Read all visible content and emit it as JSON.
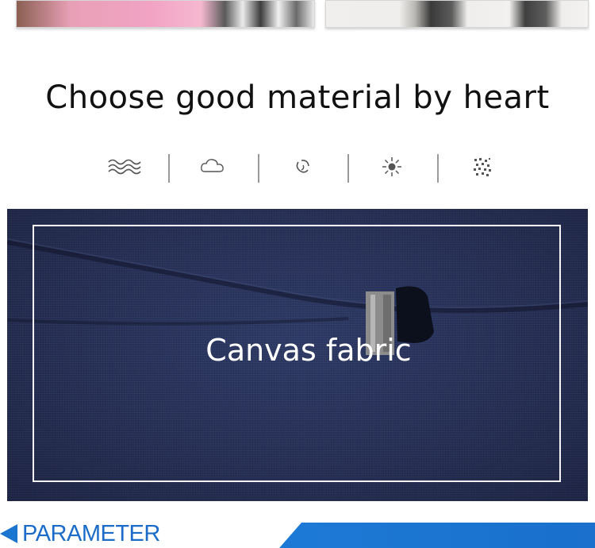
{
  "section_title": "Choose good material by heart",
  "feature_icons": [
    "waves-icon",
    "cloud-icon",
    "swirl-icon",
    "sun-icon",
    "dots-icon"
  ],
  "fabric": {
    "label": "Canvas fabric"
  },
  "parameter": {
    "label": "PARAMETER"
  },
  "colors": {
    "fabric": "#28315a",
    "accent": "#1b75d0",
    "text": "#111111"
  }
}
